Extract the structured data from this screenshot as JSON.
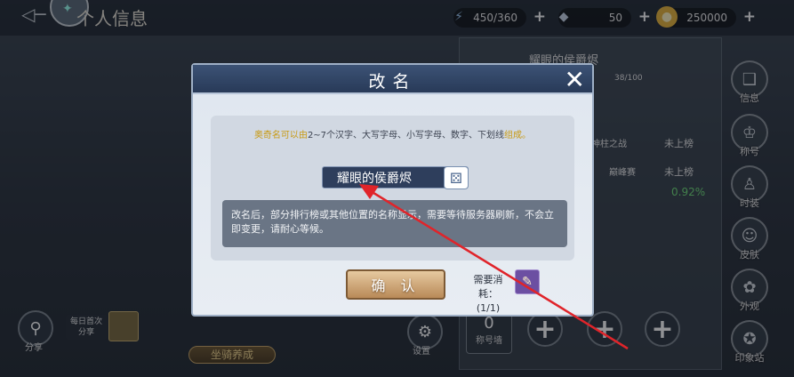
{
  "header": {
    "title": "个人信息",
    "stamina": "450/360",
    "diamond": "50",
    "coin": "250000"
  },
  "side_menu": [
    "信息",
    "称号",
    "时装",
    "皮肤",
    "外观",
    "印象站"
  ],
  "bottom_left": {
    "share": "分享",
    "daily_share": "每日首次分享",
    "mount": "坐骑养成",
    "settings": "设置",
    "title_wall_count": "0",
    "title_wall": "称号墙"
  },
  "background_panel": {
    "player_name": "耀眼的侯爵烬",
    "progress": "38/100",
    "rank_1_label": "神柱之战",
    "rank_1_value": "未上榜",
    "rank_2_label": "巅峰赛",
    "rank_2_value": "未上榜",
    "percent": "0.92%"
  },
  "dialog": {
    "title": "改名",
    "note_highlight_1": "奥奇名可以由",
    "note_middle": "2~7个汉字、大写字母、小写字母、数字、下划线",
    "note_highlight_2": "组成。",
    "name_value": "耀眼的侯爵烬",
    "info_text": "改名后，部分排行榜或其他位置的名称显示，需要等待服务器刷新，不会立即变更，请耐心等候。",
    "confirm": "确 认",
    "cost_label": "需要消耗：",
    "cost_count": "(1/1)"
  },
  "icons": {
    "close": "close-icon",
    "dice": "dice-icon",
    "scroll": "rename-scroll-icon",
    "stamina": "stamina-icon",
    "diamond": "diamond-icon",
    "coin": "coin-icon"
  },
  "colors": {
    "dialog_header": "#283a58",
    "confirm_button": "#b98a58",
    "highlight_text": "#c89a13",
    "arrow": "#e0242a"
  }
}
